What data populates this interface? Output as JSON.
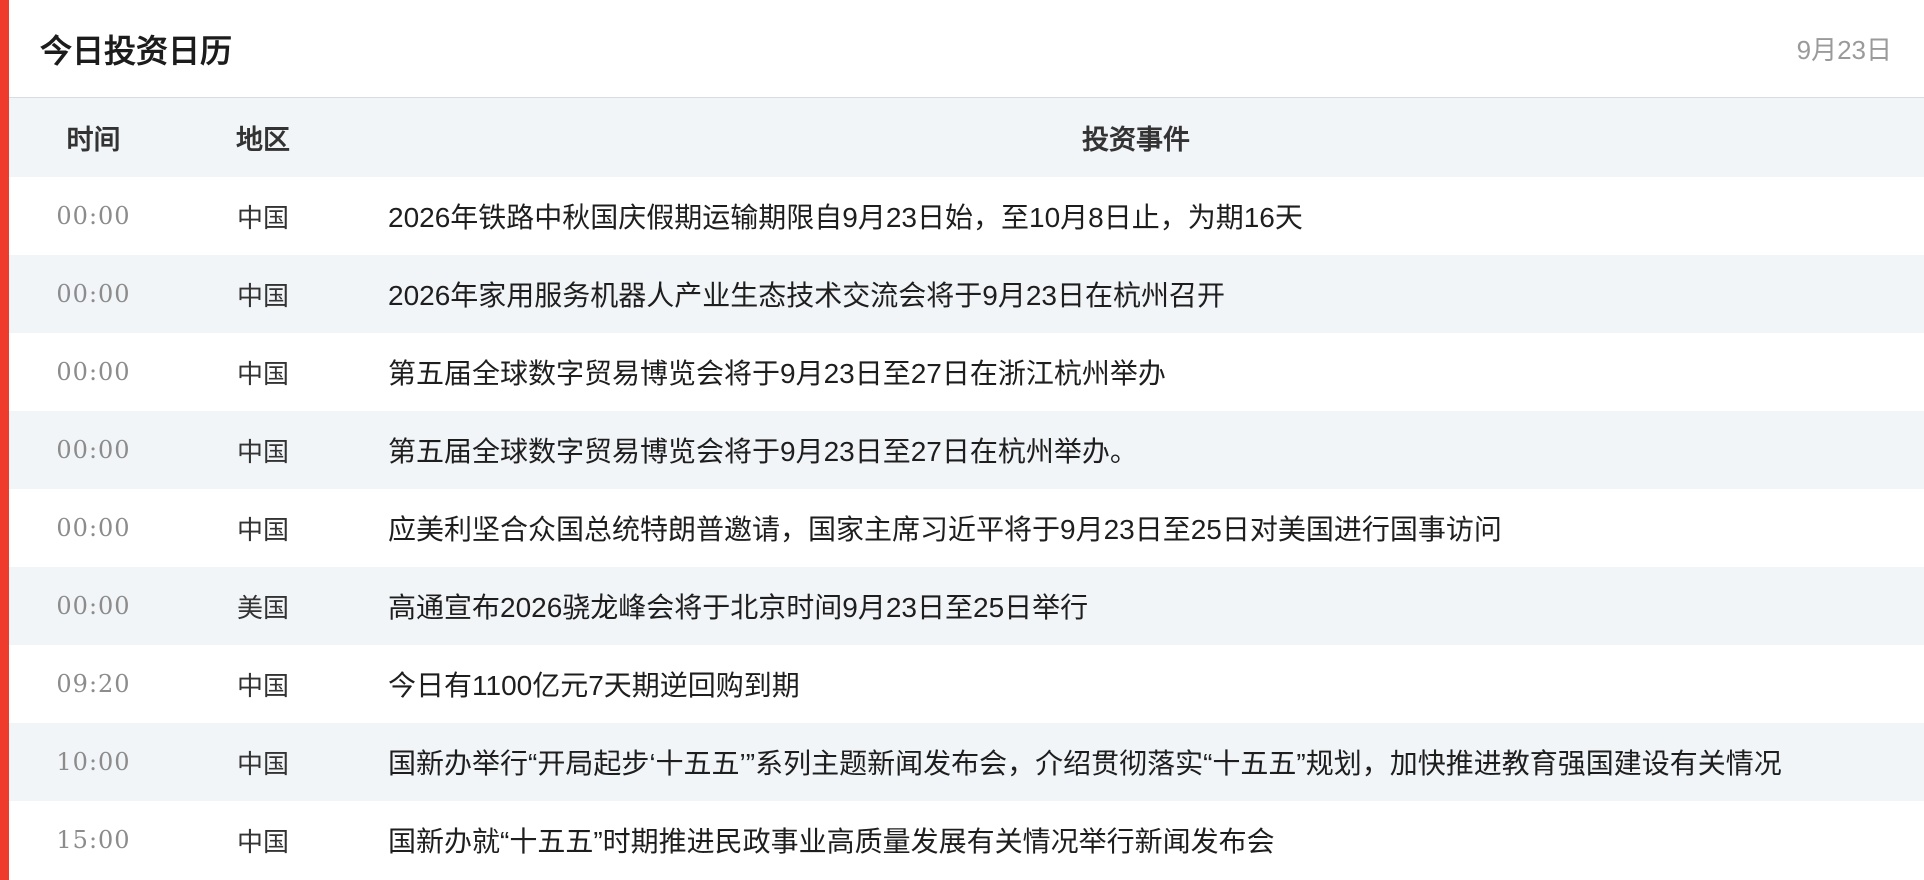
{
  "header": {
    "title": "今日投资日历",
    "date": "9月23日"
  },
  "table": {
    "columns": {
      "time": "时间",
      "region": "地区",
      "event": "投资事件"
    },
    "rows": [
      {
        "time": "00:00",
        "region": "中国",
        "event": "2026年铁路中秋国庆假期运输期限自9月23日始，至10月8日止，为期16天"
      },
      {
        "time": "00:00",
        "region": "中国",
        "event": "2026年家用服务机器人产业生态技术交流会将于9月23日在杭州召开"
      },
      {
        "time": "00:00",
        "region": "中国",
        "event": "第五届全球数字贸易博览会将于9月23日至27日在浙江杭州举办"
      },
      {
        "time": "00:00",
        "region": "中国",
        "event": "第五届全球数字贸易博览会将于9月23日至27日在杭州举办。"
      },
      {
        "time": "00:00",
        "region": "中国",
        "event": "应美利坚合众国总统特朗普邀请，国家主席习近平将于9月23日至25日对美国进行国事访问"
      },
      {
        "time": "00:00",
        "region": "美国",
        "event": "高通宣布2026骁龙峰会将于北京时间9月23日至25日举行"
      },
      {
        "time": "09:20",
        "region": "中国",
        "event": "今日有1100亿元7天期逆回购到期"
      },
      {
        "time": "10:00",
        "region": "中国",
        "event": "国新办举行“开局起步‘十五五’”系列主题新闻发布会，介绍贯彻落实“十五五”规划，加快推进教育强国建设有关情况"
      },
      {
        "time": "15:00",
        "region": "中国",
        "event": "国新办就“十五五”时期推进民政事业高质量发展有关情况举行新闻发布会"
      }
    ]
  },
  "colors": {
    "accent": "#ee3b2c",
    "row_alt": "#f2f5f8"
  }
}
